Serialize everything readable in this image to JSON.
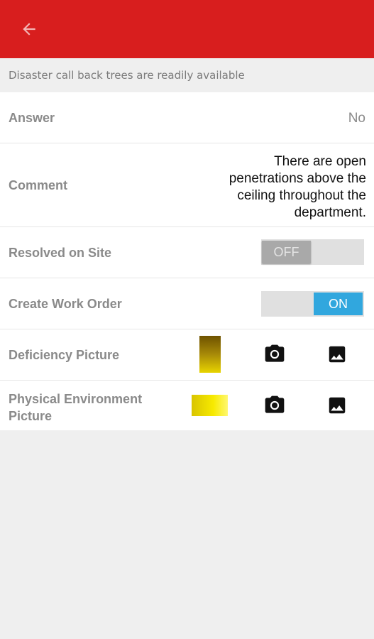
{
  "toolbar": {
    "back_icon": "arrow-back-icon",
    "color": "#d81e1e"
  },
  "question": "Disaster call back trees are readily available",
  "fields": {
    "answer_label": "Answer",
    "answer_value": "No",
    "comment_label": "Comment",
    "comment_value": "There are open penetrations above the ceiling throughout the department.",
    "resolved_label": "Resolved on Site",
    "resolved_state": "OFF",
    "work_order_label": "Create Work Order",
    "work_order_state": "ON",
    "deficiency_label": "Deficiency Picture",
    "physical_label": "Physical Environment Picture"
  },
  "icons": {
    "camera": "camera-icon",
    "gallery": "image-gallery-icon"
  },
  "colors": {
    "accent": "#31a7de",
    "label": "#8a8a8a"
  }
}
